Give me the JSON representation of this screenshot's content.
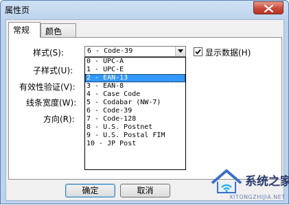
{
  "window": {
    "title": "属性页"
  },
  "tabs": [
    {
      "label": "常规"
    },
    {
      "label": "颜色"
    }
  ],
  "form": {
    "style_label": "样式(S):",
    "substyle_label": "子样式(U):",
    "validation_label": "有效性验证(V):",
    "line_width_label": "线条宽度(W):",
    "direction_label": "方向(R):",
    "style_value": "6 - Code-39",
    "show_data_label": "显示数据(H)",
    "show_data_checked": true
  },
  "dropdown": {
    "selected_index": 2,
    "options": [
      "0 - UPC-A",
      "1 - UPC-E",
      "2 - EAN-13",
      "3 - EAN-8",
      "4 - Case Code",
      "5 - Codabar (NW-7)",
      "6 - Code-39",
      "7 - Code-128",
      "8 - U.S. Postnet",
      "9 - U.S. Postal FIM",
      "10 - JP Post"
    ]
  },
  "buttons": {
    "ok": "确定",
    "cancel": "取消"
  },
  "watermark": {
    "name": "系统之家",
    "url": "XITONGZHIJIA.NET"
  },
  "icons": {
    "close": "close-icon",
    "dropdown": "chevron-down-icon",
    "check": "checkmark-icon",
    "logo": "house-logo-icon"
  }
}
